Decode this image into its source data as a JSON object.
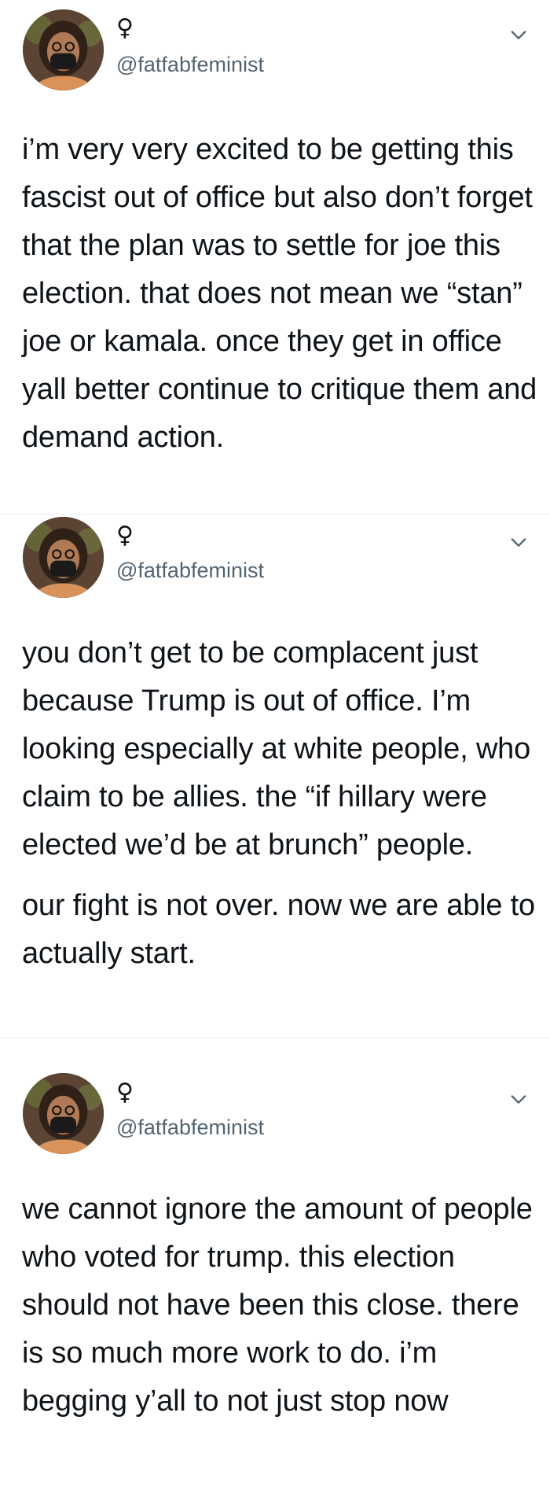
{
  "tweets": [
    {
      "name_symbol": "♀",
      "handle": "@fatfabfeminist",
      "paragraphs": [
        "i’m very very excited to be getting this fascist out of office but also don’t forget that the plan was to settle for joe this election. that does not mean we “stan” joe or kamala. once they get in office yall better continue to critique them and demand action."
      ]
    },
    {
      "name_symbol": "♀",
      "handle": "@fatfabfeminist",
      "paragraphs": [
        "you don’t get to be complacent just because Trump is out of office. I’m looking especially at white people, who claim to be allies. the “if hillary were elected we’d be at brunch” people.",
        "our fight is not over. now we are able to actually start."
      ]
    },
    {
      "name_symbol": "♀",
      "handle": "@fatfabfeminist",
      "paragraphs": [
        "we cannot ignore the amount of people who voted for trump. this election should not have been this close. there is so much more work to do. i’m begging y’all to not just stop now"
      ]
    }
  ],
  "icons": {
    "avatar": "profile-photo",
    "menu": "chevron-down-icon"
  },
  "colors": {
    "text": "#0f1419",
    "secondary": "#536471",
    "divider": "#e6e9eb"
  }
}
